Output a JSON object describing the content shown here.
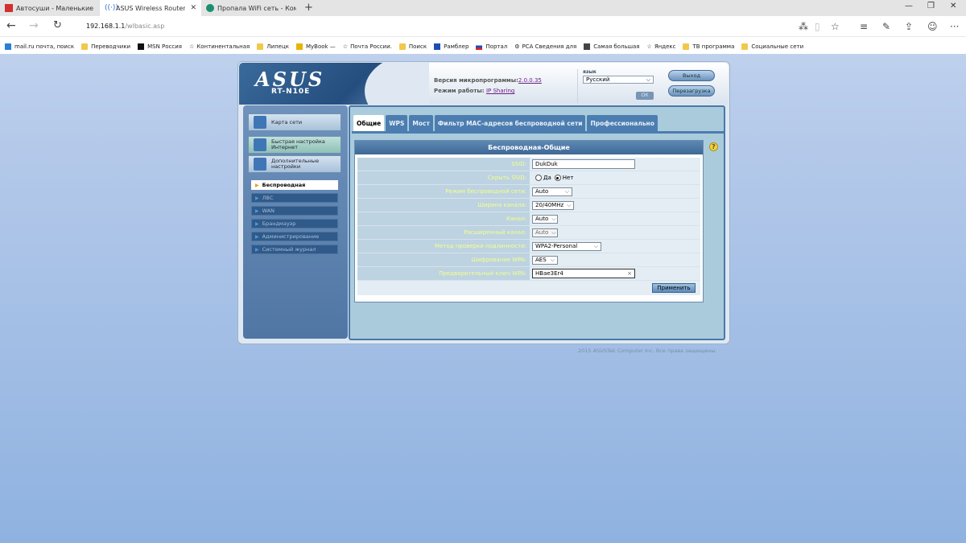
{
  "browser": {
    "tabs": [
      {
        "label": "Автосуши - Маленькие ро.",
        "active": false,
        "icon_color": "#d32f2f"
      },
      {
        "label": "ASUS Wireless Router R",
        "active": true,
        "icon_color": "#2a6fd0"
      },
      {
        "label": "Пропала WiFi сеть - Компь",
        "active": false,
        "icon_color": "#1b8f6e"
      }
    ],
    "new_tab": "+",
    "url_host": "192.168.1.1",
    "url_path": "/wlbasic.asp",
    "window_controls": [
      "—",
      "❐",
      "✕"
    ],
    "bookmarks": [
      "mail.ru почта, поиск",
      "Переводчики",
      "MSN Россия",
      "Континентальная",
      "Липецк",
      "MyBook —",
      "Почта России.",
      "Поиск",
      "Рамблер",
      "Портал",
      "РСА Сведения для",
      "Самая большая",
      "Яндекс",
      "ТВ программа",
      "Социальные сети"
    ]
  },
  "router": {
    "logo": "ASUS",
    "model": "RT-N10E",
    "firmware_label": "Версия микропрограммы:",
    "firmware_value": "2.0.0.35",
    "mode_label": "Режим работы:",
    "mode_value": "IP Sharing",
    "lang_label": "язык",
    "lang_value": "Русский",
    "ok_label": "ОК",
    "logout_label": "Выход",
    "reboot_label": "Перезагрузка",
    "menu": [
      {
        "label": "Карта сети"
      },
      {
        "label": "Быстрая настройка Интернет"
      },
      {
        "label": "Дополнительные настройки"
      }
    ],
    "submenu": [
      "Беспроводная",
      "ЛВС",
      "WAN",
      "Брандмауэр",
      "Администрирование",
      "Системный журнал"
    ],
    "tabs": [
      "Общие",
      "WPS",
      "Мост",
      "Фильтр MAC-адресов беспроводной сети",
      "Профессионально"
    ],
    "form_title": "Беспроводная-Общие",
    "fields": {
      "ssid_label": "SSID:",
      "ssid_value": "DukDuk",
      "hide_label": "Скрыть SSID:",
      "hide_yes": "Да",
      "hide_no": "Нет",
      "mode_label": "Режим беспроводной сети:",
      "mode_value": "Auto",
      "width_label": "Ширина канала:",
      "width_value": "20/40MHz",
      "channel_label": "Канал:",
      "channel_value": "Auto",
      "ext_label": "Расширенный канал:",
      "ext_value": "Auto",
      "auth_label": "Метод проверки подлинности:",
      "auth_value": "WPA2-Personal",
      "enc_label": "Шифрование WPA:",
      "enc_value": "AES",
      "key_label": "Предварительный ключ WPA:",
      "key_value": "HBae3Er4"
    },
    "apply_label": "Применить",
    "footer": "2015 ASUSTek Computer Inc. Все права защищены."
  },
  "colors": {
    "accent": "#4c7db0",
    "panel": "#a9cbdc",
    "label_text": "#f7ff86"
  }
}
